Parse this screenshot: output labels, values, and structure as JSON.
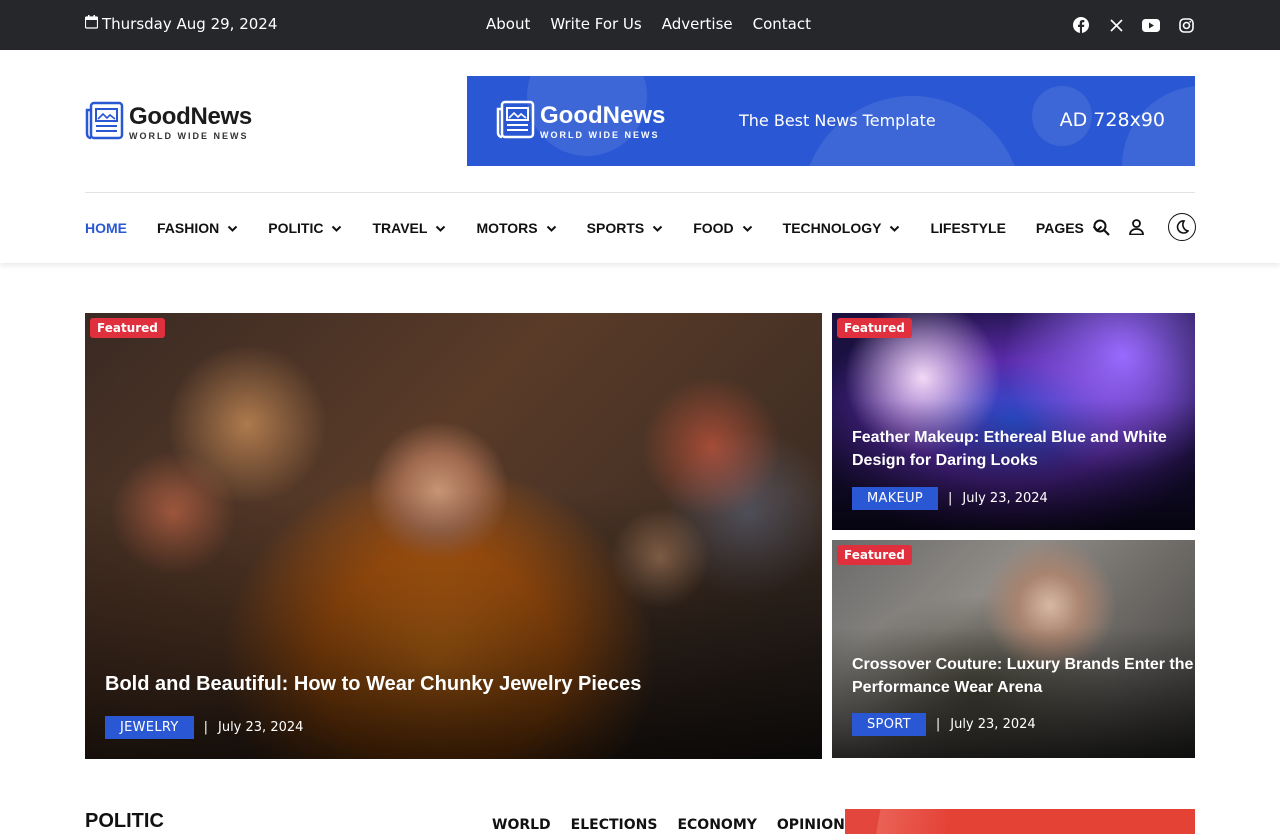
{
  "topbar": {
    "date": "Thursday Aug 29, 2024",
    "links": [
      "About",
      "Write For Us",
      "Advertise",
      "Contact"
    ],
    "social": [
      "facebook-icon",
      "x-icon",
      "youtube-icon",
      "instagram-icon"
    ]
  },
  "logo": {
    "name": "GoodNews",
    "tagline": "WORLD WIDE NEWS"
  },
  "ad": {
    "logo_name": "GoodNews",
    "logo_tagline": "WORLD WIDE NEWS",
    "tagline": "The Best News Template",
    "size": "AD 728x90"
  },
  "nav": {
    "items": [
      {
        "label": "HOME",
        "dropdown": false,
        "active": true
      },
      {
        "label": "FASHION",
        "dropdown": true
      },
      {
        "label": "POLITIC",
        "dropdown": true
      },
      {
        "label": "TRAVEL",
        "dropdown": true
      },
      {
        "label": "MOTORS",
        "dropdown": true
      },
      {
        "label": "SPORTS",
        "dropdown": true
      },
      {
        "label": "FOOD",
        "dropdown": true
      },
      {
        "label": "TECHNOLOGY",
        "dropdown": true
      },
      {
        "label": "LIFESTYLE",
        "dropdown": false
      },
      {
        "label": "PAGES",
        "dropdown": true
      }
    ]
  },
  "featured": [
    {
      "badge": "Featured",
      "title": "Bold and Beautiful: How to Wear Chunky Jewelry Pieces",
      "category": "JEWELRY",
      "date": "July 23, 2024"
    },
    {
      "badge": "Featured",
      "title_line1": "Feather Makeup: Ethereal Blue and White",
      "title_line2": "Design for Daring Looks",
      "category": "MAKEUP",
      "date": "July 23, 2024"
    },
    {
      "badge": "Featured",
      "title_line1": "Crossover Couture: Luxury Brands Enter the",
      "title_line2": "Performance Wear Arena",
      "category": "SPORT",
      "date": "July 23, 2024"
    }
  ],
  "politic": {
    "title": "POLITIC",
    "tabs": [
      "WORLD",
      "ELECTIONS",
      "ECONOMY",
      "OPINION"
    ]
  },
  "colors": {
    "accent": "#2a58d4",
    "badge": "#e0303d",
    "topbar": "#25272b"
  }
}
